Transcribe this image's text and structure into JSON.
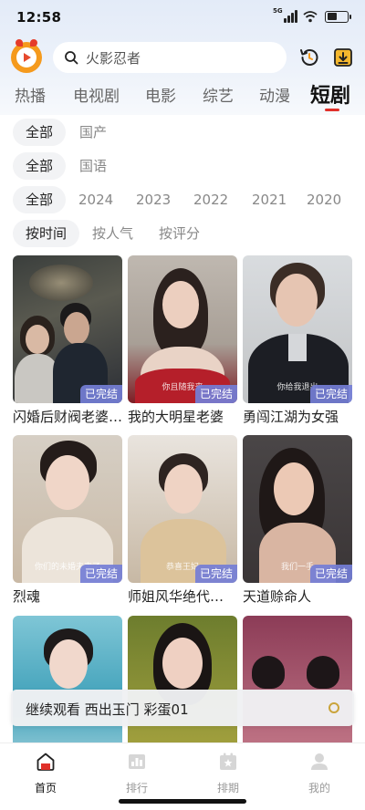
{
  "status_bar": {
    "time": "12:58",
    "network": "5G"
  },
  "header": {
    "search_placeholder": "火影忍者",
    "icons": [
      "app-logo",
      "search-icon",
      "history-icon",
      "download-icon"
    ]
  },
  "category_tabs": [
    {
      "label": "热播",
      "active": false
    },
    {
      "label": "电视剧",
      "active": false
    },
    {
      "label": "电影",
      "active": false
    },
    {
      "label": "综艺",
      "active": false
    },
    {
      "label": "动漫",
      "active": false
    },
    {
      "label": "短剧",
      "active": true
    }
  ],
  "filters": {
    "region": [
      "全部",
      "国产"
    ],
    "language": [
      "全部",
      "国语"
    ],
    "year": [
      "全部",
      "2024",
      "2023",
      "2022",
      "2021",
      "2020"
    ],
    "sort": [
      "按时间",
      "按人气",
      "按评分"
    ]
  },
  "cards": [
    {
      "title": "闪婚后财阀老婆…",
      "badge": "已完结",
      "subtitle": ""
    },
    {
      "title": "我的大明星老婆",
      "badge": "已完结",
      "subtitle": "你且随我来"
    },
    {
      "title": "勇闯江湖为女强",
      "badge": "已完结",
      "subtitle": "你给我退出"
    },
    {
      "title": "烈魂",
      "badge": "已完结",
      "subtitle": "你们的未婚夫来了"
    },
    {
      "title": "师姐风华绝代…",
      "badge": "已完结",
      "subtitle": "恭喜王妃"
    },
    {
      "title": "天道赊命人",
      "badge": "已完结",
      "subtitle": "我们一手"
    },
    {
      "title": "",
      "badge": "",
      "subtitle": ""
    },
    {
      "title": "",
      "badge": "",
      "subtitle": ""
    },
    {
      "title": "",
      "badge": "",
      "subtitle": ""
    }
  ],
  "continue_watching": {
    "text": "继续观看  西出玉门  彩蛋01"
  },
  "bottom_nav": [
    {
      "label": "首页",
      "icon": "home-icon",
      "active": true
    },
    {
      "label": "排行",
      "icon": "ranking-icon",
      "active": false
    },
    {
      "label": "排期",
      "icon": "schedule-icon",
      "active": false
    },
    {
      "label": "我的",
      "icon": "profile-icon",
      "active": false
    }
  ],
  "colors": {
    "accent": "#e0302a",
    "badge": "#747ed6",
    "logo": "#f59a1d"
  }
}
